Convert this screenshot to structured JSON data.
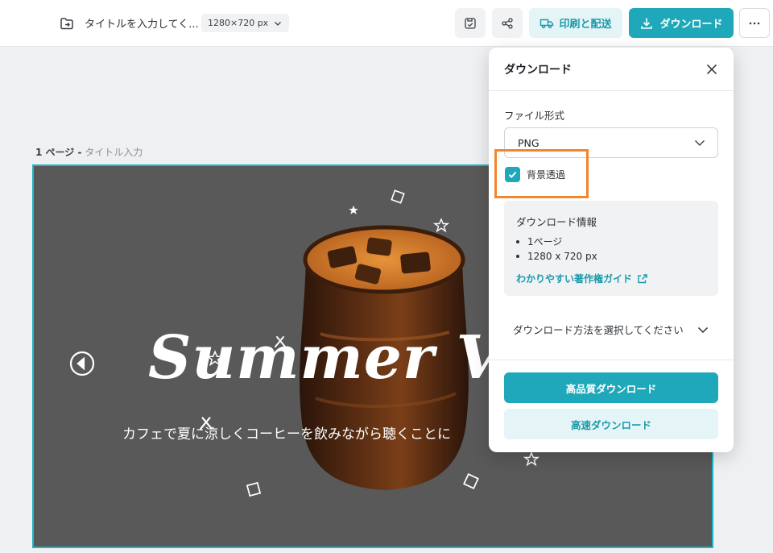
{
  "header": {
    "title": "タイトルを入力してく...",
    "size_chip": "1280×720 px",
    "print_label": "印刷と配送",
    "download_label": "ダウンロード"
  },
  "canvas": {
    "page_number": "1 ページ -",
    "page_title": "タイトル入力",
    "design_title": "Summer V",
    "design_body": "カフェで夏に涼しくコーヒーを飲みながら聴くことに",
    "background_color": "#595959"
  },
  "download_panel": {
    "title": "ダウンロード",
    "file_format_label": "ファイル形式",
    "file_format_value": "PNG",
    "transparent_bg_label": "背景透過",
    "transparent_bg_checked": true,
    "info_title": "ダウンロード情報",
    "info_items": [
      "1ページ",
      "1280 x 720 px"
    ],
    "info_link": "わかりやすい著作権ガイド",
    "method_label": "ダウンロード方法を選択してください",
    "hq_button": "高品質ダウンロード",
    "fast_button": "高速ダウンロード"
  },
  "colors": {
    "accent": "#1fa8b9",
    "accent_light": "#e5f5f7",
    "highlight": "#f0862d",
    "selection_border": "#20b4c6"
  }
}
